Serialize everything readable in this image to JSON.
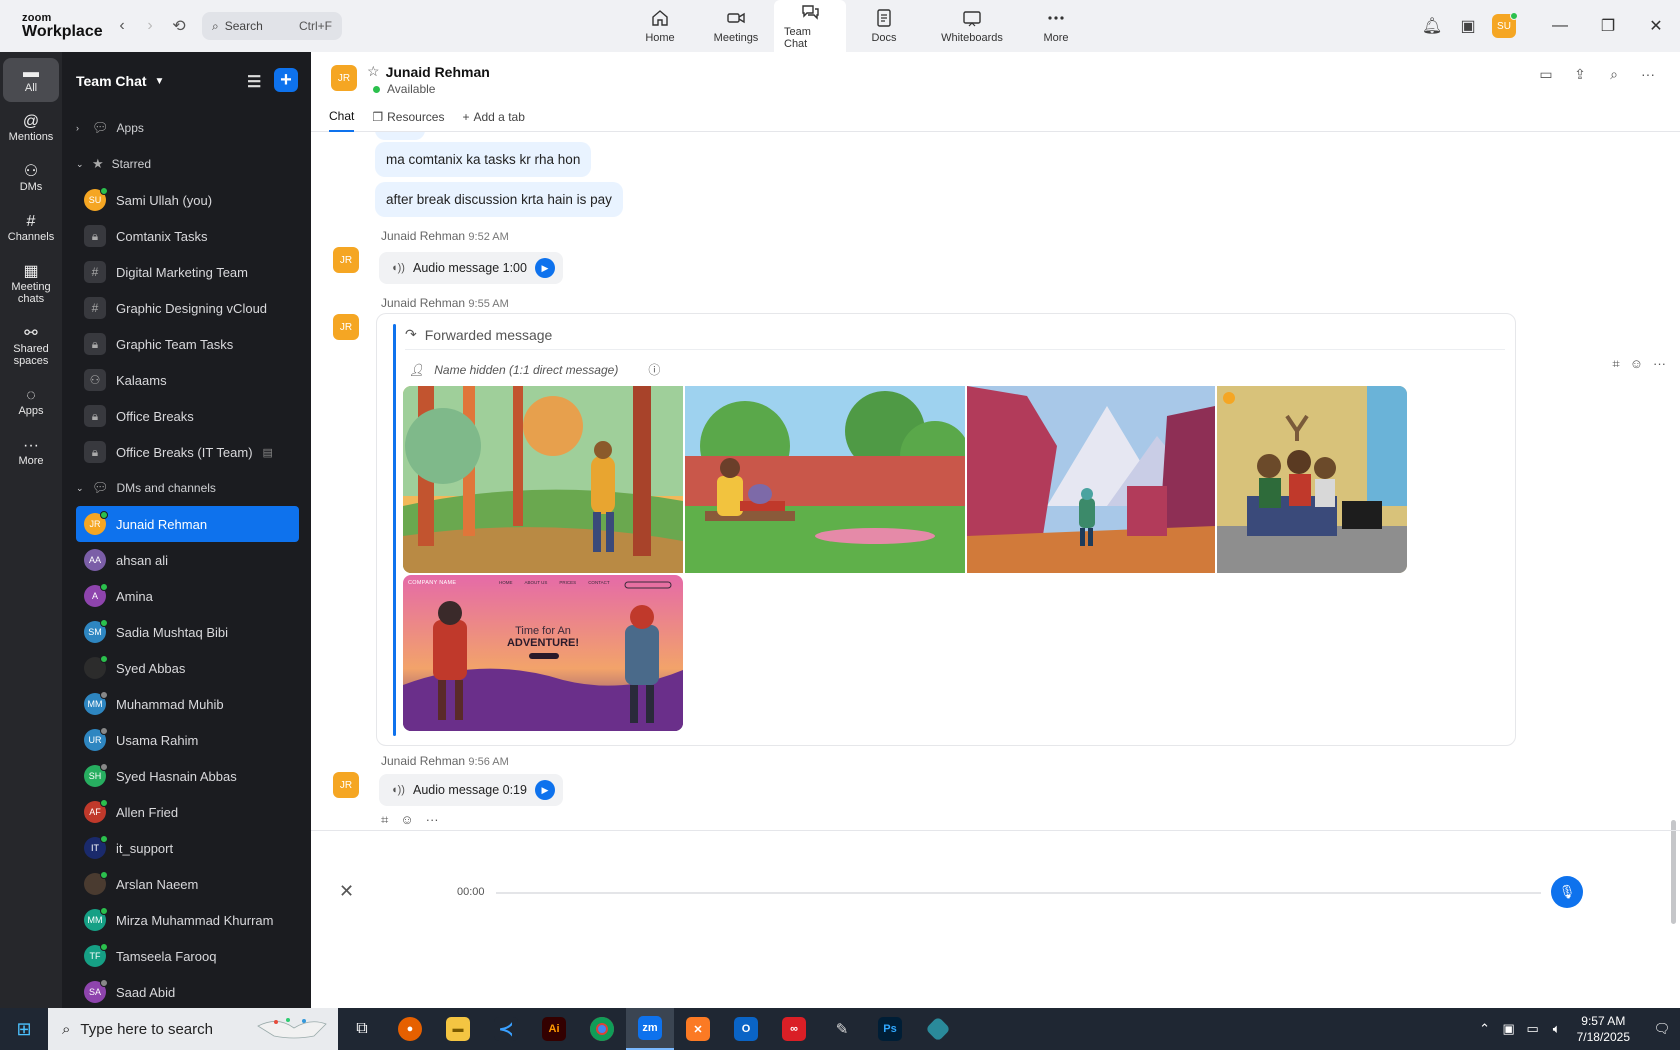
{
  "topbar": {
    "logo_small": "zoom",
    "logo_big": "Workplace",
    "search_label": "Search",
    "search_shortcut": "Ctrl+F",
    "tabs": [
      {
        "label": "Home",
        "icon": "home-icon"
      },
      {
        "label": "Meetings",
        "icon": "video-icon"
      },
      {
        "label": "Team Chat",
        "icon": "chat-icon"
      },
      {
        "label": "Docs",
        "icon": "doc-icon"
      },
      {
        "label": "Whiteboards",
        "icon": "whiteboard-icon"
      },
      {
        "label": "More",
        "icon": "more-icon"
      }
    ],
    "user_initials": "SU"
  },
  "rail": [
    {
      "label": "All",
      "icon": "chat-icon"
    },
    {
      "label": "Mentions",
      "icon": "at-icon"
    },
    {
      "label": "DMs",
      "icon": "people-icon"
    },
    {
      "label": "Channels",
      "icon": "hash-icon"
    },
    {
      "label": "Meeting chats",
      "icon": "calendar-icon"
    },
    {
      "label": "Shared spaces",
      "icon": "share-icon"
    },
    {
      "label": "Apps",
      "icon": "apps-icon"
    },
    {
      "label": "More",
      "icon": "more-icon"
    }
  ],
  "sidebar": {
    "title": "Team Chat",
    "sec_apps": "Apps",
    "sec_starred": "Starred",
    "sec_dms": "DMs and channels",
    "starred": [
      {
        "label": "Sami Ullah (you)",
        "kind": "avatar",
        "initials": "SU",
        "color": "#f5a623",
        "status": "on"
      },
      {
        "label": "Comtanix Tasks",
        "kind": "lock"
      },
      {
        "label": "Digital Marketing Team",
        "kind": "hash"
      },
      {
        "label": "Graphic Designing vCloud",
        "kind": "hash"
      },
      {
        "label": "Graphic Team Tasks",
        "kind": "lock"
      },
      {
        "label": "Kalaams",
        "kind": "group"
      },
      {
        "label": "Office Breaks",
        "kind": "lock"
      },
      {
        "label": "Office Breaks (IT Team)",
        "kind": "lock"
      }
    ],
    "dms": [
      {
        "label": "Junaid Rehman",
        "initials": "JR",
        "color": "#f5a623",
        "status": "on",
        "selected": true
      },
      {
        "label": "ahsan ali",
        "initials": "AA",
        "color": "#7b5ea7",
        "status": "none"
      },
      {
        "label": "Amina",
        "initials": "A",
        "color": "#8e44ad",
        "status": "on"
      },
      {
        "label": "Sadia Mushtaq Bibi",
        "initials": "SM",
        "color": "#2e86c1",
        "status": "on"
      },
      {
        "label": "Syed Abbas",
        "initials": "",
        "color": "#2c2c2c",
        "status": "on"
      },
      {
        "label": "Muhammad Muhib",
        "initials": "MM",
        "color": "#2e86c1",
        "status": "off"
      },
      {
        "label": "Usama Rahim",
        "initials": "UR",
        "color": "#2e86c1",
        "status": "off"
      },
      {
        "label": "Syed Hasnain Abbas",
        "initials": "SH",
        "color": "#27ae60",
        "status": "off"
      },
      {
        "label": "Allen Fried",
        "initials": "AF",
        "color": "#c0392b",
        "status": "on"
      },
      {
        "label": "it_support",
        "initials": "IT",
        "color": "#1a2a6c",
        "status": "on"
      },
      {
        "label": "Arslan Naeem",
        "initials": "",
        "color": "#4a3b30",
        "status": "on"
      },
      {
        "label": "Mirza Muhammad Khurram",
        "initials": "MM",
        "color": "#16a085",
        "status": "on"
      },
      {
        "label": "Tamseela Farooq",
        "initials": "TF",
        "color": "#16a085",
        "status": "on"
      },
      {
        "label": "Saad Abid",
        "initials": "SA",
        "color": "#8e44ad",
        "status": "off"
      }
    ]
  },
  "chat": {
    "contact_initials": "JR",
    "contact_name": "Junaid Rehman",
    "contact_status": "Available",
    "tabs": [
      "Chat",
      "Resources",
      "Add a tab"
    ],
    "bubbles": [
      "ma comtanix ka tasks kr rha hon",
      "after break discussion krta hain is pay"
    ],
    "sender": "Junaid Rehman",
    "time1": "9:52 AM",
    "audio1": "Audio message 1:00",
    "time2": "9:55 AM",
    "forwarded_label": "Forwarded message",
    "name_hidden": "Name hidden (1:1 direct message)",
    "time3": "9:56 AM",
    "audio2": "Audio message 0:19",
    "adventure_company": "COMPANY NAME",
    "adventure_nav": [
      "HOME",
      "ABOUT US",
      "PRICES",
      "CONTACT"
    ],
    "adventure_line1": "Time for An",
    "adventure_line2": "ADVENTURE!"
  },
  "composer": {
    "rec_time": "00:00"
  },
  "taskbar": {
    "search_placeholder": "Type here to search",
    "time": "9:57 AM",
    "date": "7/18/2025"
  },
  "colors": {
    "accent": "#0e72ed",
    "bubble": "#e9f3ff",
    "avatar_orange": "#f5a623",
    "sidebar_bg": "#1b1c20",
    "rail_bg": "#26272b"
  }
}
